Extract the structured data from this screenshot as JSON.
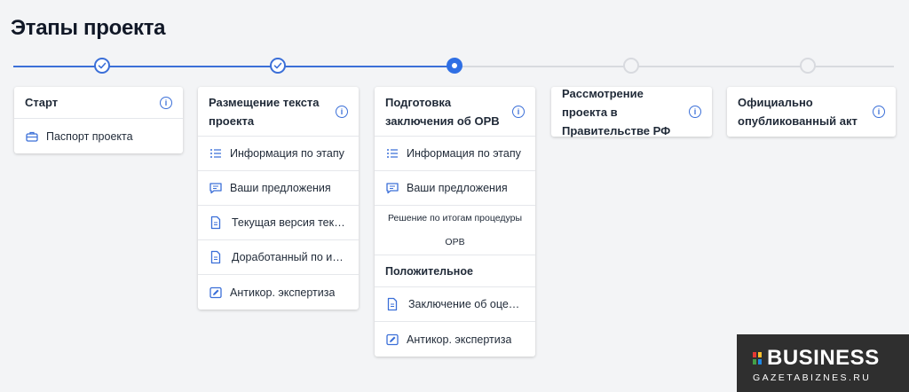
{
  "page": {
    "title": "Этапы проекта"
  },
  "colors": {
    "accent": "#3b6fd8",
    "inactive": "#d8dadf"
  },
  "stages": [
    {
      "status": "done",
      "title": "Старт",
      "items": [
        {
          "icon": "briefcase-icon",
          "label": "Паспорт проекта"
        }
      ]
    },
    {
      "status": "done",
      "title": "Размещение текста проекта",
      "items": [
        {
          "icon": "list-icon",
          "label": "Информация по этапу"
        },
        {
          "icon": "comment-icon",
          "label": "Ваши предложения"
        },
        {
          "icon": "document-icon",
          "label": "Текущая версия текс..."
        },
        {
          "icon": "document-icon",
          "label": "Доработанный по ито..."
        },
        {
          "icon": "edit-icon",
          "label": "Антикор. экспертиза"
        }
      ]
    },
    {
      "status": "current",
      "title": "Подготовка заключения об ОРВ",
      "items": [
        {
          "icon": "list-icon",
          "label": "Информация по этапу"
        },
        {
          "icon": "comment-icon",
          "label": "Ваши предложения"
        },
        {
          "label": "Решение по итогам процедуры ОРВ"
        },
        {
          "label": "Положительное"
        },
        {
          "icon": "document-icon",
          "label": "Заключение об оценк..."
        },
        {
          "icon": "edit-icon",
          "label": "Антикор. экспертиза"
        }
      ]
    },
    {
      "status": "todo",
      "title": "Рассмотрение проекта в Правительстве РФ",
      "items": []
    },
    {
      "status": "todo",
      "title": "Официально опубликованный акт",
      "items": []
    }
  ],
  "watermark": {
    "name": "BUSINESS",
    "site": "GAZETABIZNES.RU",
    "mark_colors": [
      "#e53935",
      "#fbc02d",
      "#43a047",
      "#1e88e5"
    ]
  }
}
